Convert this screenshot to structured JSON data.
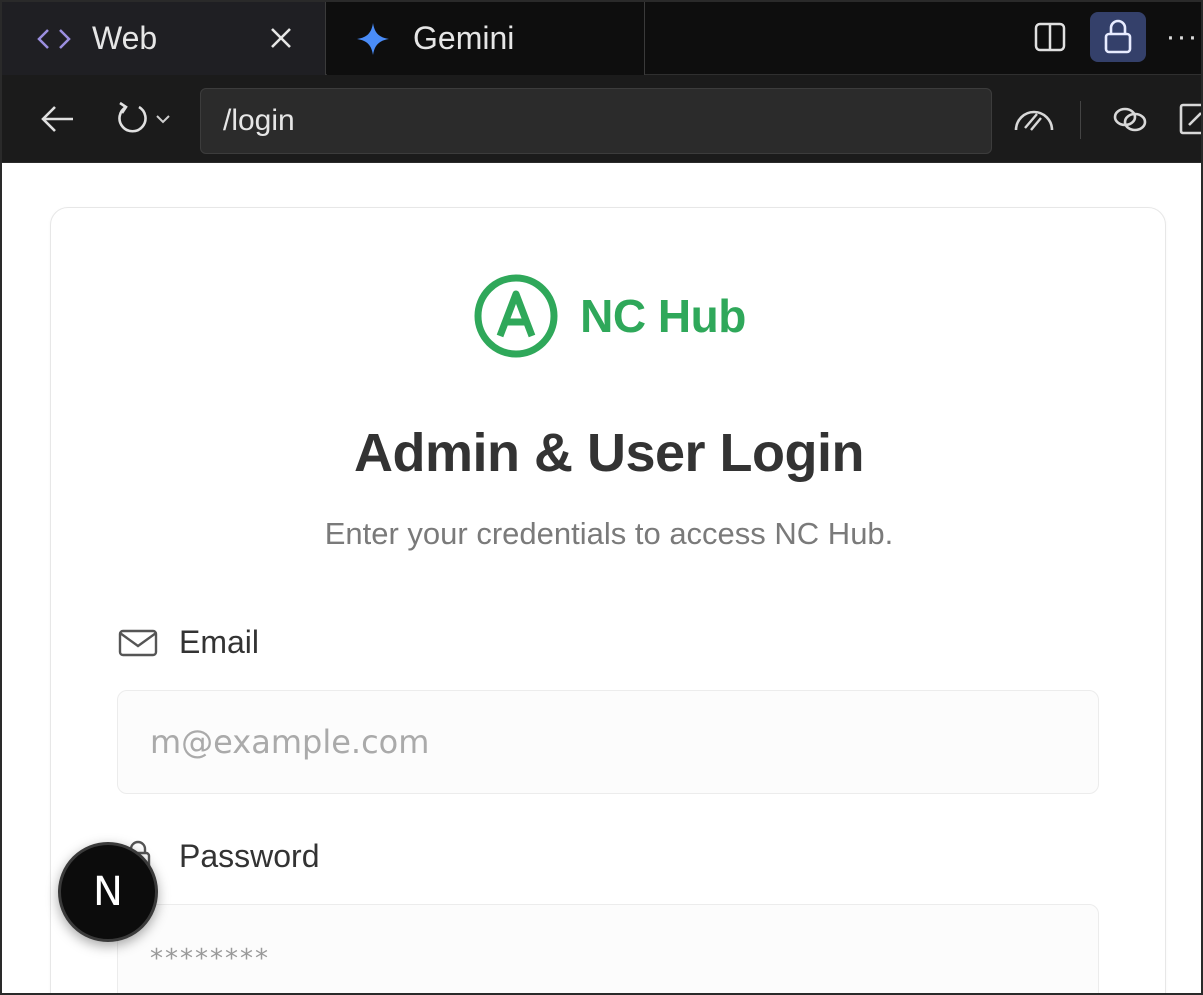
{
  "tabs": [
    {
      "label": "Web",
      "icon": "code-brackets-icon",
      "active": true,
      "closable": true
    },
    {
      "label": "Gemini",
      "icon": "gemini-sparkle-icon",
      "active": false
    }
  ],
  "toolbar": {
    "more_label": "···",
    "address": "/login"
  },
  "brand": {
    "name": "NC Hub",
    "color": "#2fa85a"
  },
  "login": {
    "title": "Admin & User Login",
    "subtitle": "Enter your credentials to access NC Hub.",
    "email_label": "Email",
    "email_placeholder": "m@example.com",
    "password_label": "Password",
    "password_placeholder": "********"
  },
  "dev_badge": {
    "letter": "N"
  }
}
